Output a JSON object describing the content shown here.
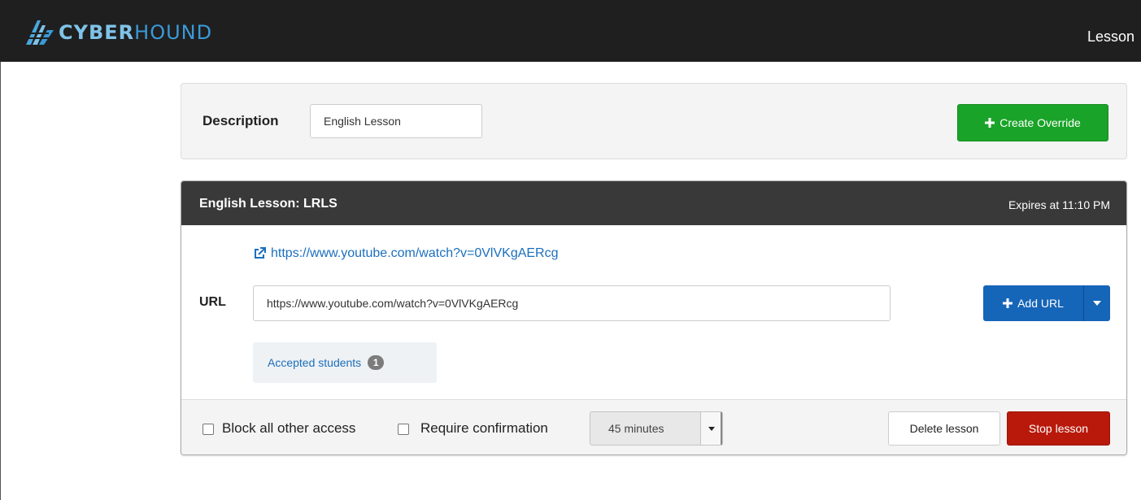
{
  "app": {
    "logo": {
      "text_part1": "CYBER",
      "text_part2": "HOUND"
    },
    "page_title": "Lesson"
  },
  "description_panel": {
    "label": "Description",
    "input_value": "English Lesson",
    "create_button": "Create Override"
  },
  "lesson": {
    "title": "English Lesson: LRLS",
    "expires": "Expires at 11:10 PM",
    "link": "https://www.youtube.com/watch?v=0VlVKgAERcg",
    "url_label": "URL",
    "url_value": "https://www.youtube.com/watch?v=0VlVKgAERcg",
    "add_url_button": "Add URL",
    "accepted_students_label": "Accepted students",
    "accepted_students_count": "1",
    "block_access_label": "Block all other access",
    "require_confirmation_label": "Require confirmation",
    "duration_selected": "45 minutes",
    "delete_button": "Delete lesson",
    "stop_button": "Stop lesson"
  },
  "colors": {
    "topbar": "#1f1f1f",
    "create_button": "#1aa329",
    "add_url_button": "#1565b8",
    "stop_button": "#b8190a",
    "link": "#1b6fbd"
  }
}
